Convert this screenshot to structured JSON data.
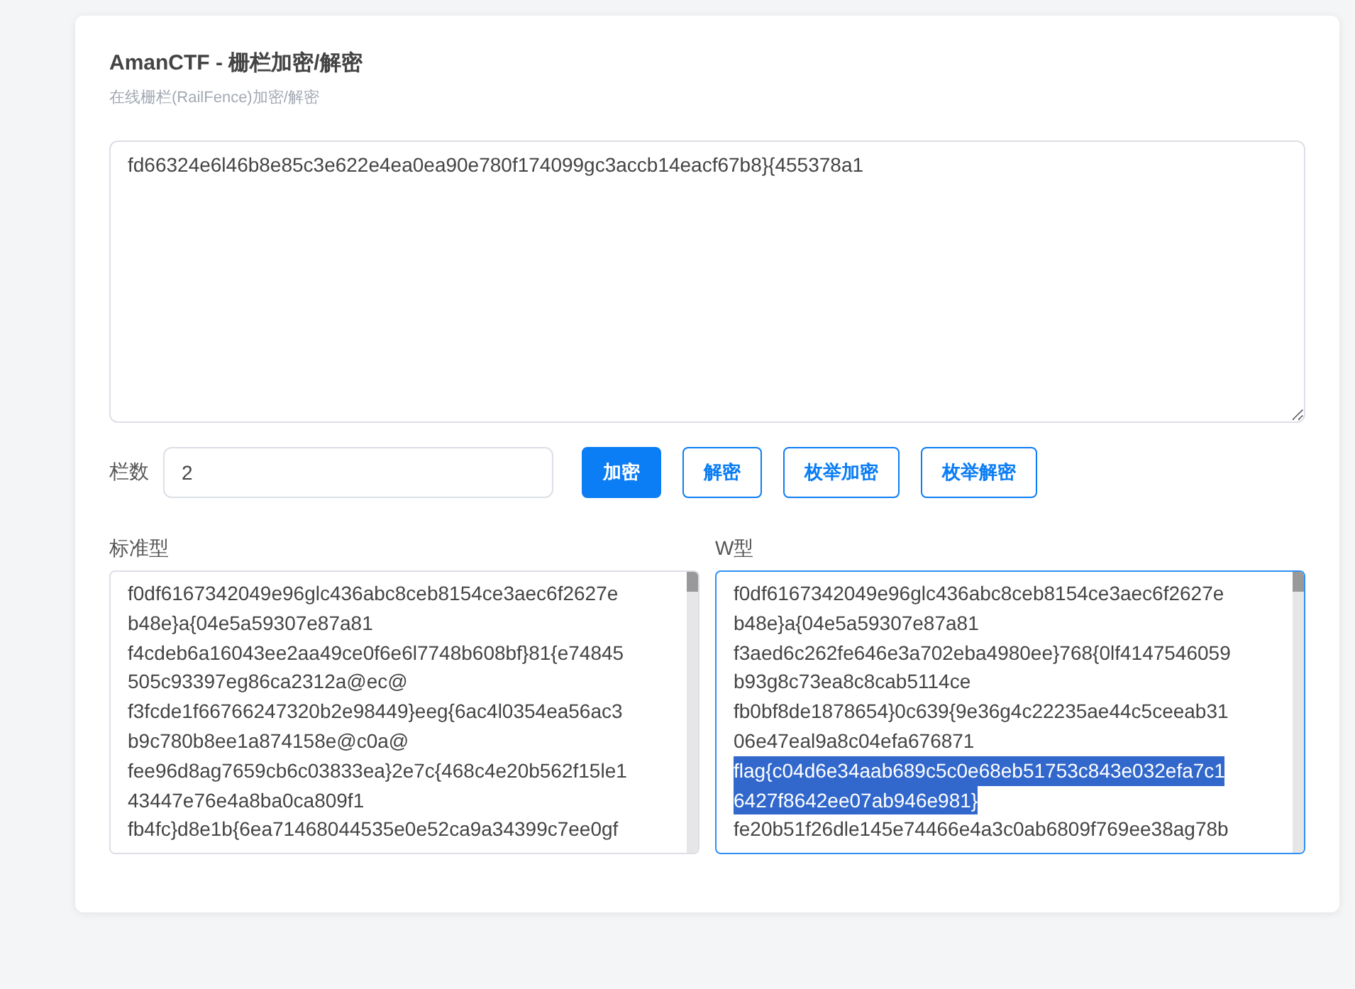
{
  "header": {
    "title": "AmanCTF - 栅栏加密/解密",
    "subtitle": "在线栅栏(RailFence)加密/解密"
  },
  "input": {
    "value": "fd66324e6l46b8e85c3e622e4ea0ea90e780f174099gc3accb14eacf67b8}{455378a1"
  },
  "rails": {
    "label": "栏数",
    "value": "2"
  },
  "buttons": [
    {
      "label": "加密",
      "kind": "primary"
    },
    {
      "label": "解密",
      "kind": "outline"
    },
    {
      "label": "枚举加密",
      "kind": "outline"
    },
    {
      "label": "枚举解密",
      "kind": "outline"
    }
  ],
  "outputs": [
    {
      "label": "标准型",
      "focused": false,
      "lines": [
        {
          "text": "f0df6167342049e96glc436abc8ceb8154ce3aec6f2627e",
          "selected": false
        },
        {
          "text": "b48e}a{04e5a59307e87a81",
          "selected": false
        },
        {
          "text": "f4cdeb6a16043ee2aa49ce0f6e6l7748b608bf}81{e74845",
          "selected": false
        },
        {
          "text": "505c93397eg86ca2312a@ec@",
          "selected": false
        },
        {
          "text": "f3fcde1f66766247320b2e98449}eeg{6ac4l0354ea56ac3",
          "selected": false
        },
        {
          "text": "b9c780b8ee1a874158e@c0a@",
          "selected": false
        },
        {
          "text": "fee96d8ag7659cb6c03833ea}2e7c{468c4e20b562f15le1",
          "selected": false
        },
        {
          "text": "43447e76e4a8ba0ca809f1",
          "selected": false
        },
        {
          "text": "fb4fc}d8e1b{6ea71468044535e0e52ca9a34399c7ee0gf",
          "selected": false
        }
      ]
    },
    {
      "label": "W型",
      "focused": true,
      "lines": [
        {
          "text": "f0df6167342049e96glc436abc8ceb8154ce3aec6f2627e",
          "selected": false
        },
        {
          "text": "b48e}a{04e5a59307e87a81",
          "selected": false
        },
        {
          "text": "f3aed6c262fe646e3a702eba4980ee}768{0lf4147546059",
          "selected": false
        },
        {
          "text": "b93g8c73ea8c8cab5114ce",
          "selected": false
        },
        {
          "text": "fb0bf8de1878654}0c639{9e36g4c22235ae44c5ceeab31",
          "selected": false
        },
        {
          "text": "06e47eal9a8c04efa676871",
          "selected": false
        },
        {
          "text": "flag{c04d6e34aab689c5c0e68eb51753c843e032efa7c1",
          "selected": true
        },
        {
          "text": "6427f8642ee07ab946e981}",
          "selected": true
        },
        {
          "text": "fe20b51f26dle145e74466e4a3c0ab6809f769ee38ag78b",
          "selected": false
        }
      ]
    }
  ]
}
